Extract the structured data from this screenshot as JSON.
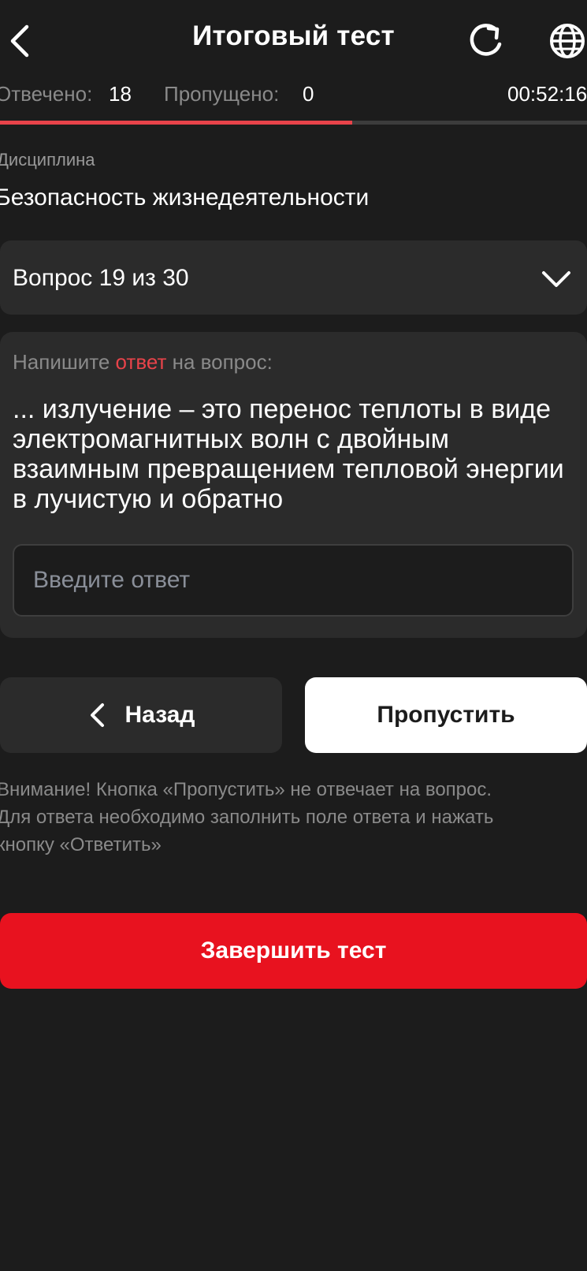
{
  "header": {
    "title": "Итоговый тест",
    "back_icon": "chevron-left-icon",
    "refresh_icon": "refresh-icon",
    "language_icon": "globe-icon"
  },
  "stats": {
    "answered_label": "Отвечено:",
    "answered_value": "18",
    "skipped_label": "Пропущено:",
    "skipped_value": "0",
    "timer": "00:52:16"
  },
  "progress": {
    "fraction": 0.6
  },
  "discipline": {
    "label": "Дисциплина",
    "value": "Безопасность жизнедеятельности"
  },
  "question_selector": {
    "label": "Вопрос 19 из 30"
  },
  "question": {
    "prompt_before": "Напишите ",
    "prompt_accent": "ответ",
    "prompt_after": " на вопрос:",
    "text": "... излучение – это перенос теплоты в виде электромагнитных волн с двойным взаимным превращением тепловой энергии в лучистую и обратно",
    "answer_placeholder": "Введите ответ",
    "answer_value": ""
  },
  "buttons": {
    "back_label": "Назад",
    "skip_label": "Пропустить",
    "finish_label": "Завершить тест"
  },
  "notice": "Внимание! Кнопка «Пропустить» не отвечает на вопрос.\nДля ответа необходимо заполнить поле ответа и нажать\nкнопку «Ответить»",
  "colors": {
    "background": "#1c1c1c",
    "surface": "#2b2b2b",
    "accent": "#e8434a",
    "finish": "#e8121f",
    "muted_text": "#8a8a8a"
  }
}
